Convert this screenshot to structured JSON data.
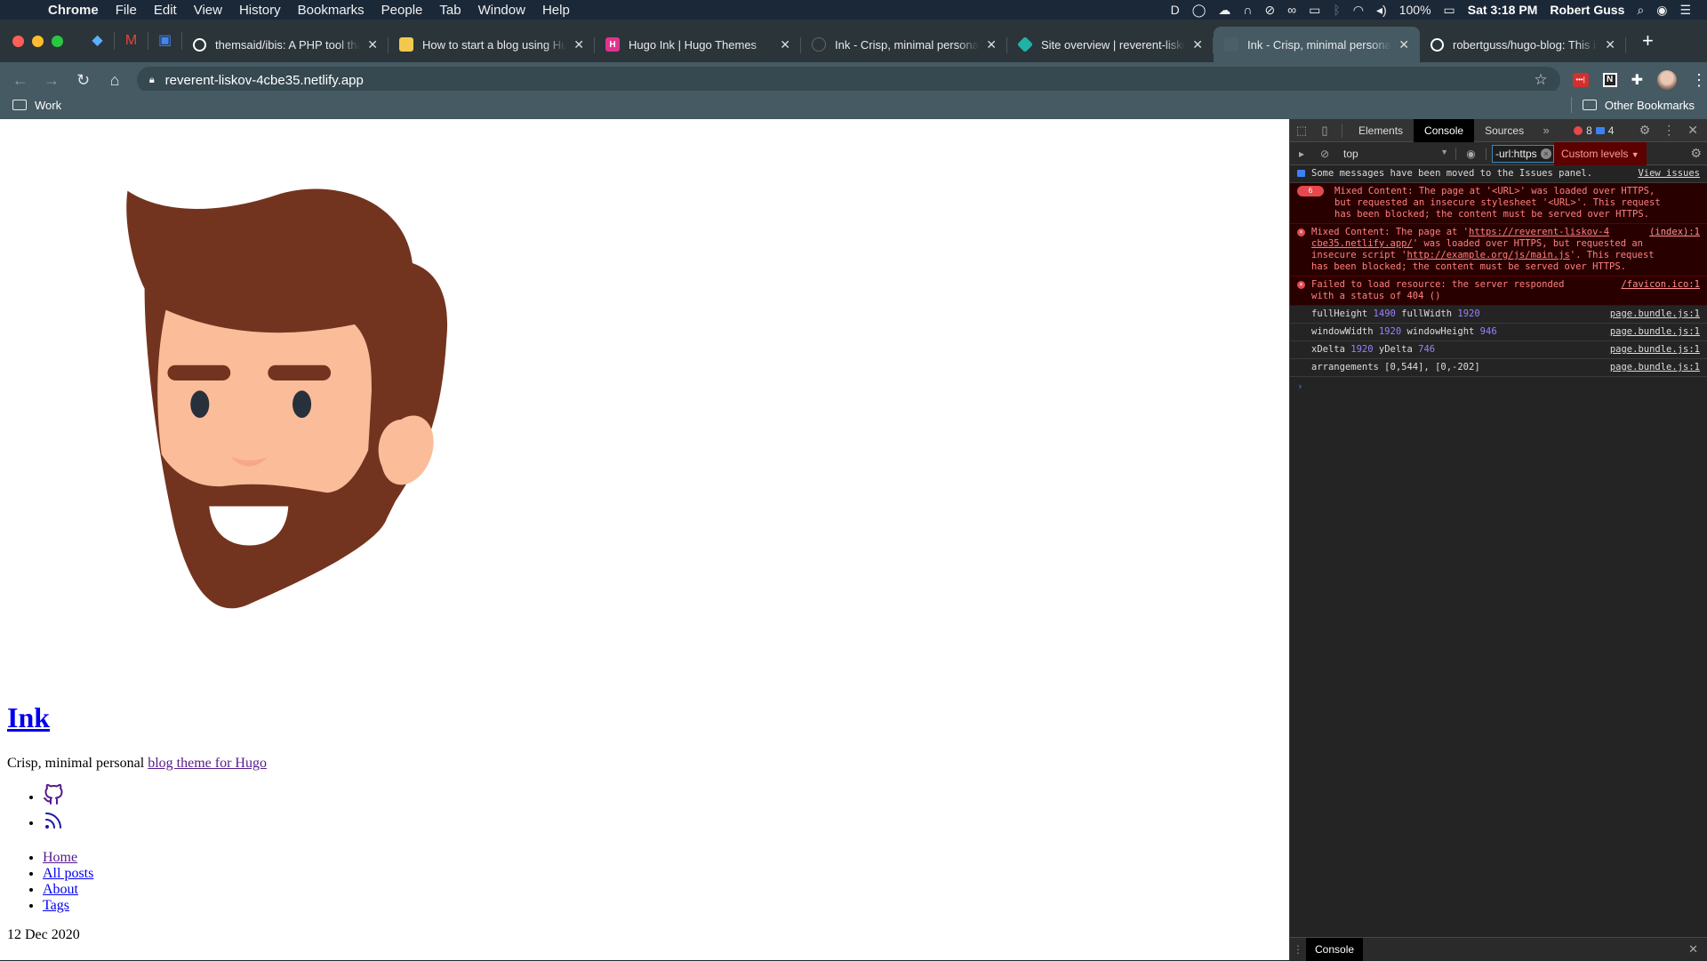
{
  "menubar": {
    "apple_icon": "apple-icon",
    "items": [
      "Chrome",
      "File",
      "Edit",
      "View",
      "History",
      "Bookmarks",
      "People",
      "Tab",
      "Window",
      "Help"
    ],
    "battery": "100%",
    "clock": "Sat 3:18 PM",
    "user": "Robert Guss"
  },
  "tabs": [
    {
      "title": "themsaid/ibis: A PHP tool that",
      "icon": "github-icon",
      "color": "#ffffff",
      "active": false
    },
    {
      "title": "How to start a blog using Hug",
      "icon": "blog-favicon",
      "color": "#f2c94c",
      "active": false
    },
    {
      "title": "Hugo Ink | Hugo Themes",
      "icon": "hugo-icon",
      "color": "#e0338f",
      "active": false
    },
    {
      "title": "Ink - Crisp, minimal personal [",
      "icon": "globe-icon",
      "color": "#666666",
      "active": false
    },
    {
      "title": "Site overview | reverent-liskov",
      "icon": "netlify-icon",
      "color": "#20b2a6",
      "active": false
    },
    {
      "title": "Ink - Crisp, minimal personal [",
      "icon": "page-icon",
      "color": "#4d5f66",
      "active": true
    },
    {
      "title": "robertguss/hugo-blog: This is",
      "icon": "github-icon",
      "color": "#ffffff",
      "active": false
    }
  ],
  "toolbar": {
    "url": "reverent-liskov-4cbe35.netlify.app"
  },
  "bookmarks": {
    "left": "Work",
    "right": "Other Bookmarks"
  },
  "page": {
    "title": "Ink",
    "tagline_prefix": "Crisp, minimal personal ",
    "tagline_link": "blog theme for Hugo",
    "social": [
      "github-icon",
      "rss-icon"
    ],
    "nav": [
      "Home",
      "All posts",
      "About",
      "Tags"
    ],
    "date": "12 Dec 2020"
  },
  "devtools": {
    "tabs": [
      "Elements",
      "Console",
      "Sources"
    ],
    "active_tab": "Console",
    "error_count": "8",
    "message_count": "4",
    "context": "top",
    "filter_value": "-url:https",
    "levels": "Custom levels",
    "drawer_tab": "Console",
    "messages": [
      {
        "type": "info",
        "text": "Some messages have been moved to the Issues panel.",
        "link": "View issues"
      },
      {
        "type": "error",
        "count": "6",
        "text": "Mixed Content: The page at '<URL>' was loaded over HTTPS,\nbut requested an insecure stylesheet '<URL>'. This request\nhas been blocked; the content must be served over HTTPS."
      },
      {
        "type": "error",
        "text_a": "Mixed Content: The page at '",
        "link_a": "https://reverent-liskov-4\ncbe35.netlify.app/",
        "text_b": "' was loaded over HTTPS, but requested an\ninsecure script '",
        "link_b": "http://example.org/js/main.js",
        "text_c": "'. This request\nhas been blocked; the content must be served over HTTPS.",
        "source": "(index):1"
      },
      {
        "type": "error",
        "text": "Failed to load resource: the server responded\nwith a status of 404 ()",
        "source": "/favicon.ico:1"
      },
      {
        "type": "log",
        "parts": [
          "fullHeight ",
          "1490",
          " fullWidth ",
          "1920"
        ],
        "source": "page.bundle.js:1"
      },
      {
        "type": "log",
        "parts": [
          "windowWidth ",
          "1920",
          " windowHeight ",
          "946"
        ],
        "source": "page.bundle.js:1"
      },
      {
        "type": "log",
        "parts": [
          "xDelta ",
          "1920",
          " yDelta ",
          "746"
        ],
        "source": "page.bundle.js:1"
      },
      {
        "type": "log",
        "parts": [
          "arrangements [0,544], [0,-202]"
        ],
        "source": "page.bundle.js:1"
      }
    ]
  }
}
